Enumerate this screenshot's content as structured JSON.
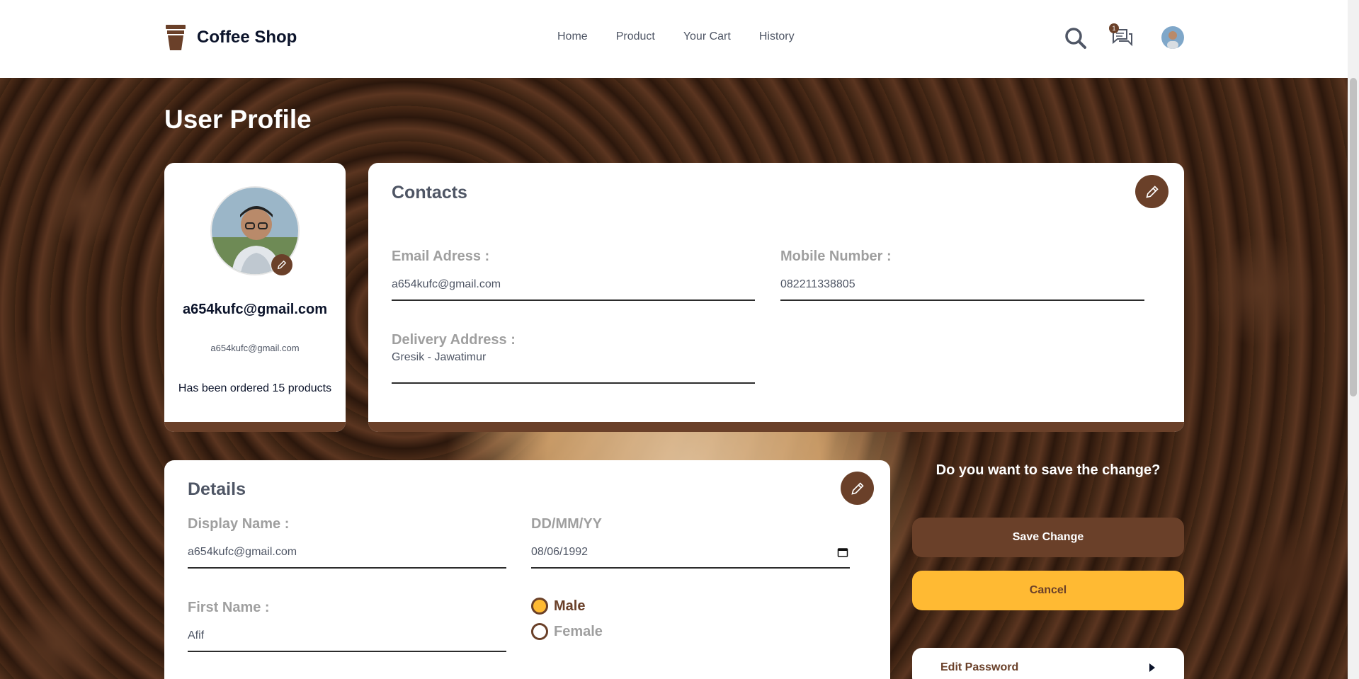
{
  "header": {
    "brand": "Coffee Shop",
    "nav": [
      "Home",
      "Product",
      "Your Cart",
      "History"
    ],
    "chat_badge": "1"
  },
  "page_title": "User Profile",
  "profile": {
    "name": "a654kufc@gmail.com",
    "email": "a654kufc@gmail.com",
    "orders": "Has been ordered 15 products"
  },
  "contacts": {
    "title": "Contacts",
    "email_label": "Email Adress :",
    "email_value": "a654kufc@gmail.com",
    "mobile_label": "Mobile Number :",
    "mobile_value": "082211338805",
    "address_label": "Delivery Address :",
    "address_value": "Gresik - Jawatimur"
  },
  "details": {
    "title": "Details",
    "display_name_label": "Display Name :",
    "display_name_value": "a654kufc@gmail.com",
    "dob_label": "DD/MM/YY",
    "dob_value": "08/06/1992",
    "first_name_label": "First Name :",
    "first_name_value": "Afif",
    "gender_male": "Male",
    "gender_female": "Female",
    "gender_selected": "Male"
  },
  "actions": {
    "question": "Do you want to save the change?",
    "save": "Save Change",
    "cancel": "Cancel",
    "edit_password": "Edit Password"
  },
  "colors": {
    "brown": "#6a4029",
    "yellow": "#ffba33"
  }
}
